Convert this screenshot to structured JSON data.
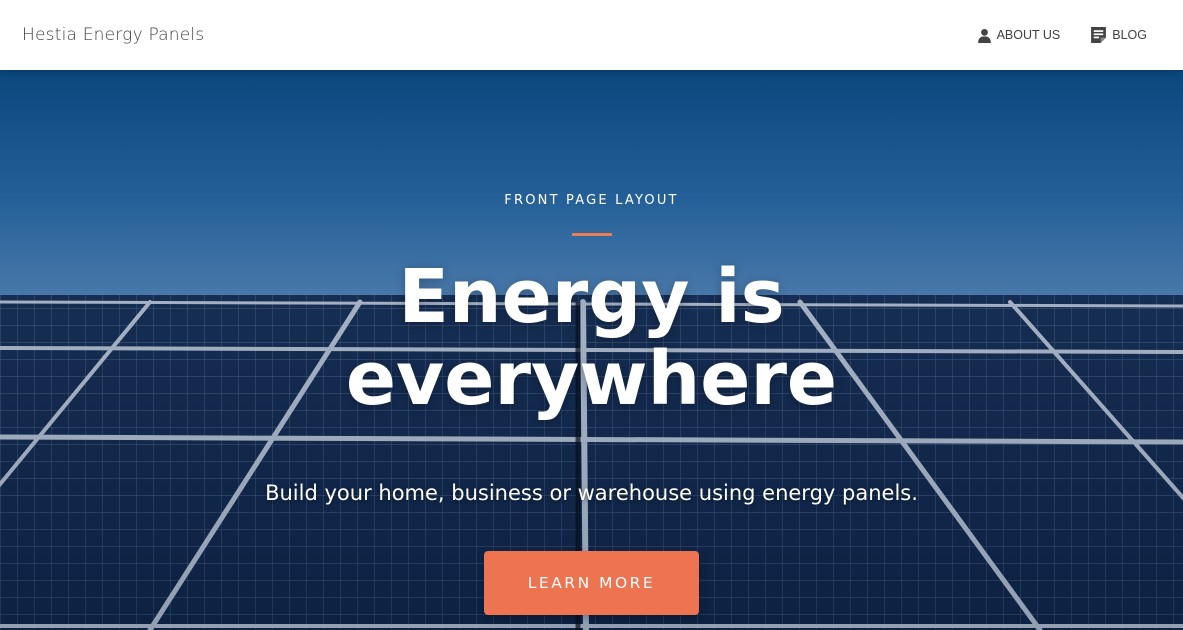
{
  "brand": {
    "name": "Hestia Energy Panels"
  },
  "nav": {
    "items": [
      {
        "label": "ABOUT US",
        "icon": "person-icon"
      },
      {
        "label": "BLOG",
        "icon": "document-icon"
      }
    ]
  },
  "hero": {
    "eyebrow": "FRONT PAGE LAYOUT",
    "headline_line1": "Energy is",
    "headline_line2": "everywhere",
    "subtitle": "Build your home, business or warehouse using energy panels.",
    "cta_label": "LEARN MORE",
    "accent_color": "#ee7350",
    "background": "solar-panels-under-blue-sky"
  }
}
